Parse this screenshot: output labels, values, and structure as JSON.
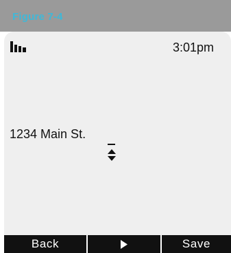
{
  "figure": {
    "label": "Figure 7-4"
  },
  "status_bar": {
    "signal_icon": "signal-strength-icon",
    "time": "3:01pm"
  },
  "editor": {
    "address_text": "1234 Main St.",
    "scroll_icon": "up-down-arrows-icon"
  },
  "softkeys": {
    "left_label": "Back",
    "center_icon": "play-right-icon",
    "right_label": "Save"
  },
  "colors": {
    "banner_background": "#9a9a9a",
    "figure_label": "#3fb8d8",
    "screen_background": "#efefef",
    "softkey_bar": "#111111",
    "softkey_text": "#ffffff"
  }
}
